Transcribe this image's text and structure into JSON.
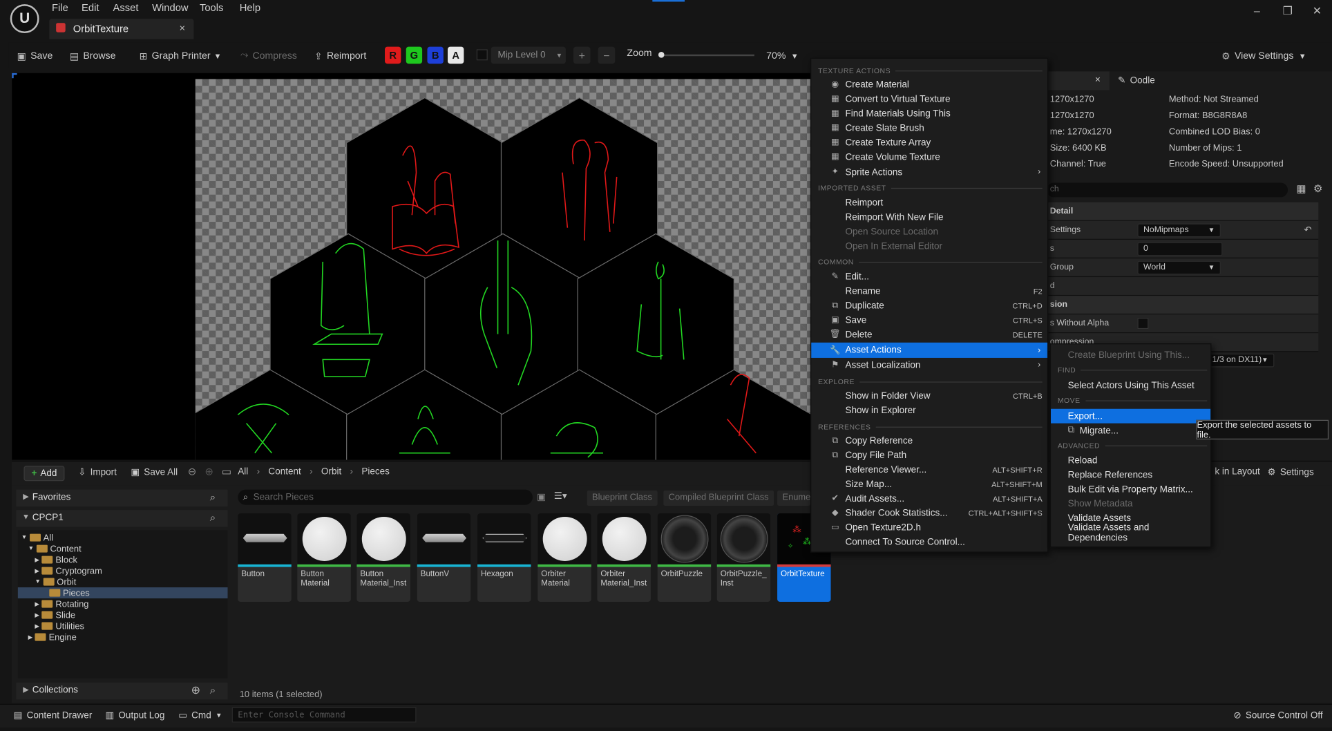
{
  "menubar": {
    "items": [
      "File",
      "Edit",
      "Asset",
      "Window",
      "Tools",
      "Help"
    ]
  },
  "tab": {
    "title": "OrbitTexture",
    "close": "×"
  },
  "window": {
    "minimize": "–",
    "restore": "❐",
    "close": "✕"
  },
  "toolbar": {
    "save": "Save",
    "browse": "Browse",
    "graph_printer": "Graph Printer",
    "compress": "Compress",
    "reimport": "Reimport",
    "channels": [
      "R",
      "G",
      "B",
      "A"
    ],
    "mip_level": "Mip Level 0",
    "zoom_label": "Zoom",
    "zoom_value": "70%",
    "view_settings": "View Settings"
  },
  "details": {
    "tab_oodle": "Oodle",
    "left_col": [
      "1270x1270",
      "1270x1270",
      "me: 1270x1270",
      "Size: 6400 KB",
      "Channel: True"
    ],
    "right_col": [
      "Method: Not Streamed",
      "Format: B8G8R8A8",
      "Combined LOD Bias: 0",
      "Number of Mips: 1",
      "Encode Speed: Unsupported"
    ],
    "search_partial": "ch",
    "section_detail": "Detail",
    "row_settings": "Settings",
    "row_settings_value": "NoMipmaps",
    "row_bias": "s",
    "row_bias_value": "0",
    "row_group": "Group",
    "row_group_value": "World",
    "row_d": "d",
    "section_sion": "sion",
    "row_alpha": "s Without Alpha",
    "row_compression": "ompression",
    "row_dx": "1/3 on DX11)"
  },
  "content_browser": {
    "add": "Add",
    "import": "Import",
    "save_all": "Save All",
    "breadcrumb": [
      "All",
      "Content",
      "Orbit",
      "Pieces"
    ],
    "favorites": "Favorites",
    "project": "CPCP1",
    "collections": "Collections",
    "search_placeholder": "Search Pieces",
    "filters": [
      "Blueprint Class",
      "Compiled Blueprint Class",
      "Enume"
    ],
    "layout": "k in Layout",
    "settings": "Settings",
    "status": "10 items (1 selected)",
    "tree": [
      "All",
      "Content",
      "Block",
      "Cryptogram",
      "Orbit",
      "Pieces",
      "Rotating",
      "Slide",
      "Utilities",
      "Engine"
    ],
    "assets": [
      {
        "name": "Button",
        "kind": "mesh-flat",
        "bar": "#18b4d4"
      },
      {
        "name": "Button\nMaterial",
        "kind": "sphere",
        "bar": "#3fb845"
      },
      {
        "name": "Button\nMaterial_Inst",
        "kind": "sphere",
        "bar": "#3fb845"
      },
      {
        "name": "ButtonV",
        "kind": "mesh-flat",
        "bar": "#18b4d4"
      },
      {
        "name": "Hexagon",
        "kind": "mesh-hex",
        "bar": "#18b4d4"
      },
      {
        "name": "Orbiter\nMaterial",
        "kind": "sphere",
        "bar": "#3fb845"
      },
      {
        "name": "Orbiter\nMaterial_Inst",
        "kind": "sphere",
        "bar": "#3fb845"
      },
      {
        "name": "OrbitPuzzle",
        "kind": "orb",
        "bar": "#3fb845"
      },
      {
        "name": "OrbitPuzzle_\nInst",
        "kind": "orb",
        "bar": "#3fb845"
      },
      {
        "name": "OrbitTexture",
        "kind": "tex",
        "bar": "#d43a3a"
      }
    ]
  },
  "statusbar": {
    "content_drawer": "Content Drawer",
    "output_log": "Output Log",
    "cmd": "Cmd",
    "console_placeholder": "Enter Console Command",
    "source_control": "Source Control Off"
  },
  "context_menu": {
    "sections": [
      "TEXTURE ACTIONS",
      "IMPORTED ASSET",
      "COMMON",
      "EXPLORE",
      "REFERENCES"
    ],
    "texture_actions": [
      "Create Material",
      "Convert to Virtual Texture",
      "Find Materials Using This",
      "Create Slate Brush",
      "Create Texture Array",
      "Create Volume Texture",
      "Sprite Actions"
    ],
    "imported": [
      "Reimport",
      "Reimport With New File",
      "Open Source Location",
      "Open In External Editor"
    ],
    "common": [
      {
        "label": "Edit...",
        "shortcut": ""
      },
      {
        "label": "Rename",
        "shortcut": "F2"
      },
      {
        "label": "Duplicate",
        "shortcut": "CTRL+D"
      },
      {
        "label": "Save",
        "shortcut": "CTRL+S"
      },
      {
        "label": "Delete",
        "shortcut": "DELETE"
      },
      {
        "label": "Asset Actions",
        "shortcut": ""
      },
      {
        "label": "Asset Localization",
        "shortcut": ""
      }
    ],
    "explore": [
      {
        "label": "Show in Folder View",
        "shortcut": "CTRL+B"
      },
      {
        "label": "Show in Explorer",
        "shortcut": ""
      }
    ],
    "references": [
      {
        "label": "Copy Reference",
        "shortcut": ""
      },
      {
        "label": "Copy File Path",
        "shortcut": ""
      },
      {
        "label": "Reference Viewer...",
        "shortcut": "ALT+SHIFT+R"
      },
      {
        "label": "Size Map...",
        "shortcut": "ALT+SHIFT+M"
      },
      {
        "label": "Audit Assets...",
        "shortcut": "ALT+SHIFT+A"
      },
      {
        "label": "Shader Cook Statistics...",
        "shortcut": "CTRL+ALT+SHIFT+S"
      },
      {
        "label": "Open Texture2D.h",
        "shortcut": ""
      },
      {
        "label": "Connect To Source Control...",
        "shortcut": ""
      }
    ]
  },
  "submenu": {
    "create_bp": "Create Blueprint Using This...",
    "sections": [
      "FIND",
      "MOVE",
      "ADVANCED"
    ],
    "select_actors": "Select Actors Using This Asset",
    "export": "Export...",
    "migrate": "Migrate...",
    "advanced": [
      "Reload",
      "Replace References",
      "Bulk Edit via Property Matrix...",
      "Show Metadata",
      "Validate Assets",
      "Validate Assets and Dependencies"
    ]
  },
  "tooltip": "Export the selected assets to file.",
  "colors": {
    "highlight": "#0e6fe0",
    "red_line": "#e01818",
    "green_line": "#22d622"
  }
}
